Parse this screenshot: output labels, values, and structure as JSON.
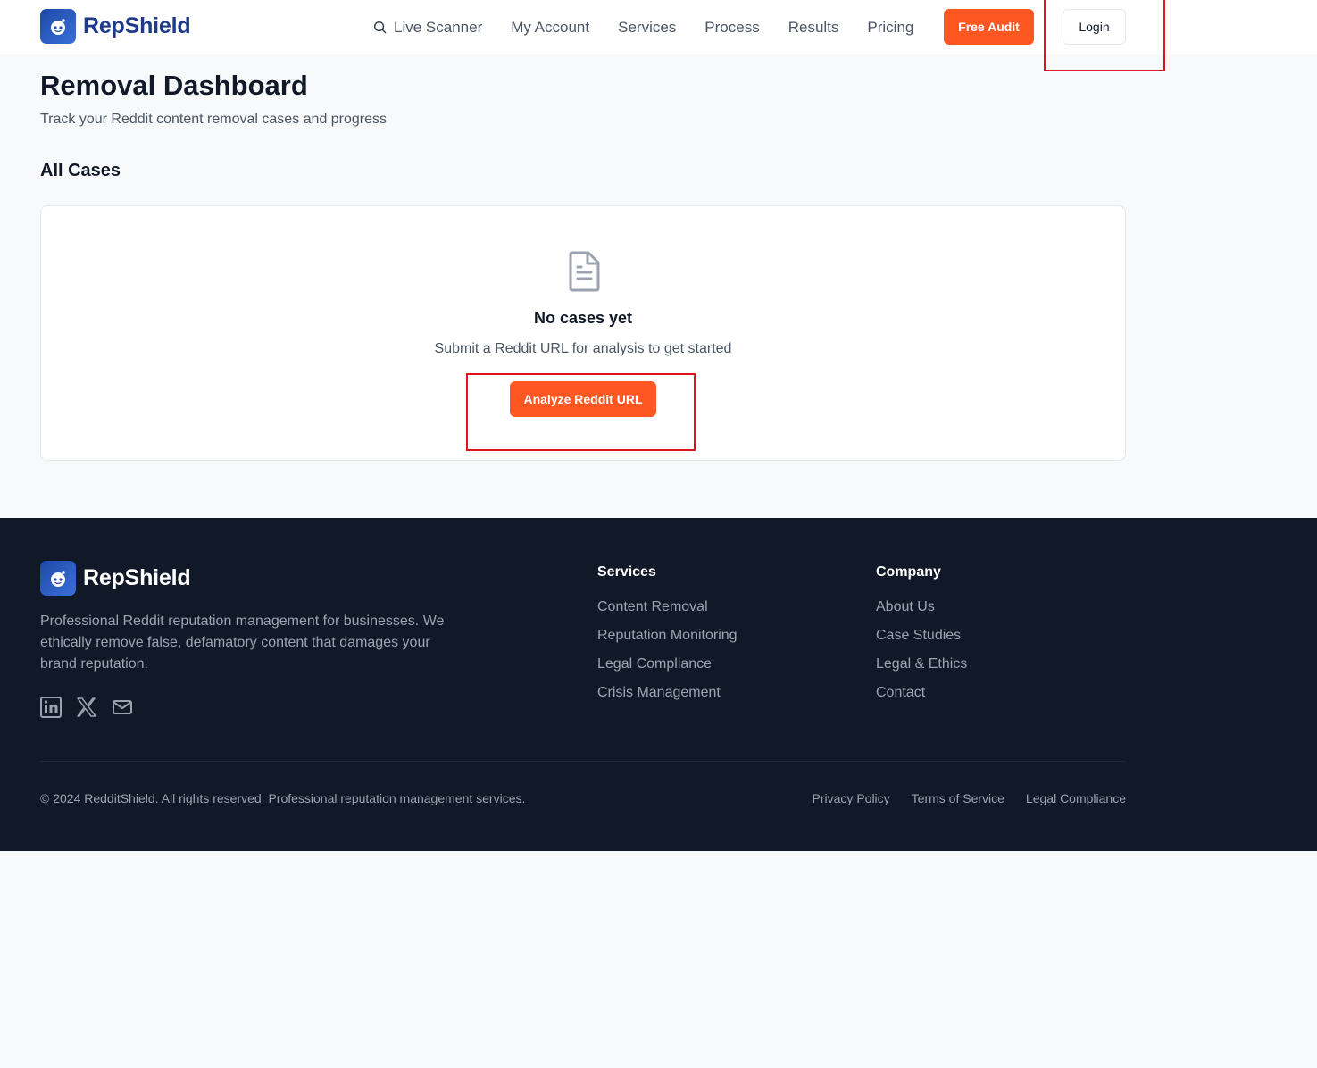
{
  "header": {
    "brand": "RepShield",
    "nav": [
      {
        "label": "Live Scanner",
        "icon": "search-icon"
      },
      {
        "label": "My Account"
      },
      {
        "label": "Services"
      },
      {
        "label": "Process"
      },
      {
        "label": "Results"
      },
      {
        "label": "Pricing"
      }
    ],
    "free_audit_label": "Free Audit",
    "login_label": "Login"
  },
  "main": {
    "title": "Removal Dashboard",
    "subtitle": "Track your Reddit content removal cases and progress",
    "section_title": "All Cases",
    "empty": {
      "icon": "document-icon",
      "title": "No cases yet",
      "subtitle": "Submit a Reddit URL for analysis to get started",
      "button_label": "Analyze Reddit URL"
    }
  },
  "footer": {
    "brand": "RepShield",
    "description": "Professional Reddit reputation management for businesses. We ethically remove false, defamatory content that damages your brand reputation.",
    "social_icons": [
      "linkedin-icon",
      "x-icon",
      "mail-icon"
    ],
    "services": {
      "heading": "Services",
      "links": [
        "Content Removal",
        "Reputation Monitoring",
        "Legal Compliance",
        "Crisis Management"
      ]
    },
    "company": {
      "heading": "Company",
      "links": [
        "About Us",
        "Case Studies",
        "Legal & Ethics",
        "Contact"
      ]
    },
    "copyright": "© 2024 RedditShield. All rights reserved. Professional reputation management services.",
    "legal_links": [
      "Privacy Policy",
      "Terms of Service",
      "Legal Compliance"
    ]
  },
  "colors": {
    "accent": "#ff5722",
    "brand": "#1e3a8a",
    "footer_bg": "#111827",
    "highlight": "#e0141e"
  }
}
